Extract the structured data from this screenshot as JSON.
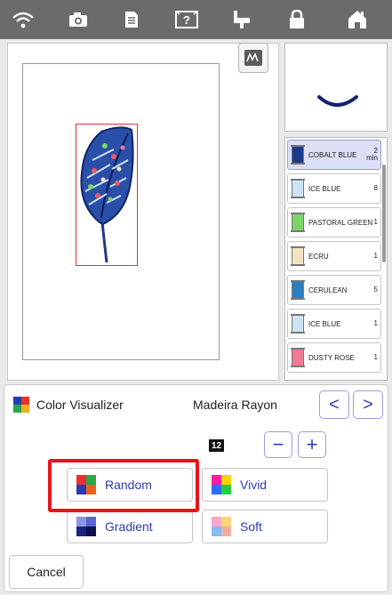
{
  "topbar": {
    "icons": [
      "wifi-icon",
      "camera-icon",
      "document-icon",
      "help-icon",
      "thread-spool-icon",
      "lock-icon",
      "home-icon"
    ],
    "color": "#6b6b6b"
  },
  "threads": [
    {
      "name": "COBALT BLUE",
      "count": "2",
      "sub": "min",
      "color": "#1d3a8a",
      "selected": true
    },
    {
      "name": "ICE BLUE",
      "count": "8",
      "color": "#cde4f5"
    },
    {
      "name": "PASTORAL GREEN",
      "count": "1",
      "color": "#7ed46a"
    },
    {
      "name": "ECRU",
      "count": "1",
      "color": "#f4e3c2"
    },
    {
      "name": "CERULEAN",
      "count": "5",
      "color": "#2a7fc0"
    },
    {
      "name": "ICE BLUE",
      "count": "1",
      "color": "#cde4f5"
    },
    {
      "name": "DUSTY ROSE",
      "count": "1",
      "color": "#ee7a94"
    }
  ],
  "visualizer": {
    "title": "Color Visualizer",
    "brand": "Madeira Rayon",
    "prev_label": "<",
    "next_label": ">",
    "count": "12",
    "minus_label": "−",
    "plus_label": "+",
    "modes": {
      "random": "Random",
      "vivid": "Vivid",
      "gradient": "Gradient",
      "soft": "Soft"
    },
    "cancel": "Cancel"
  },
  "accent": "#2b3cb0",
  "highlight_color": "#e8141a"
}
